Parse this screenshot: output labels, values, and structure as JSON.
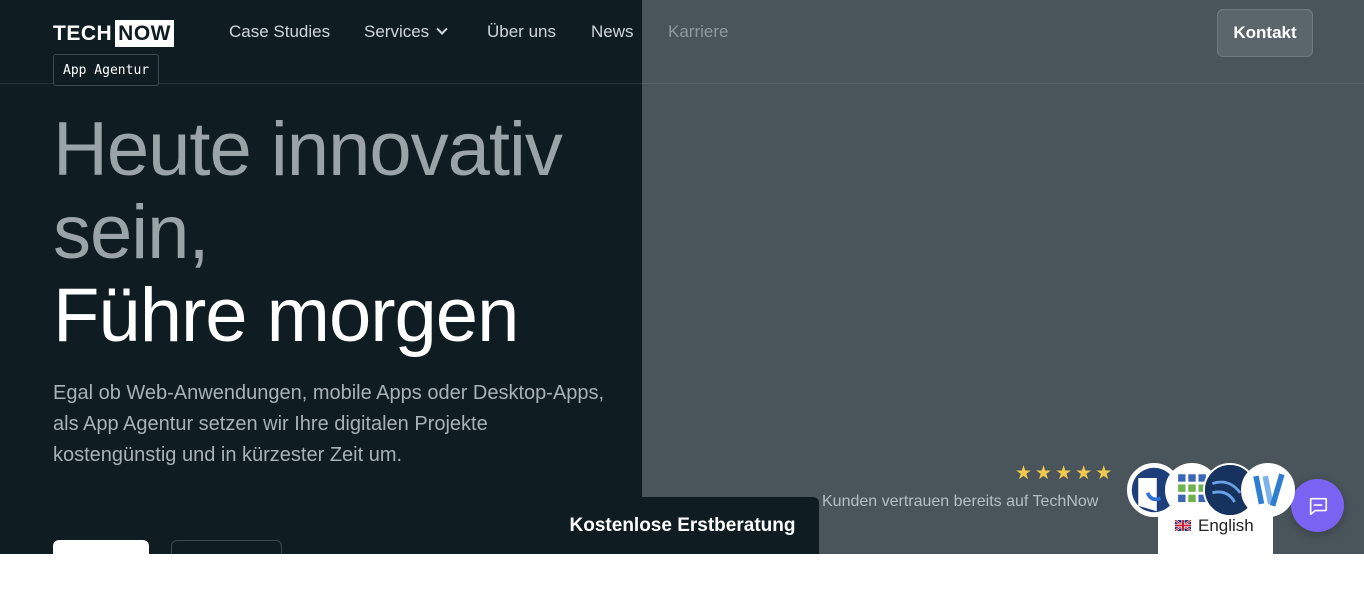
{
  "header": {
    "logo_part1": "TECH",
    "logo_part2": "NOW",
    "tag": "App Agentur",
    "nav": [
      {
        "label": "Case Studies"
      },
      {
        "label": "Services"
      },
      {
        "label": "Über uns"
      },
      {
        "label": "News"
      },
      {
        "label": "Karriere"
      }
    ],
    "contact_label": "Kontakt"
  },
  "hero": {
    "headline_line1": "Heute innovativ",
    "headline_line2": "sein,",
    "headline_line3": "Führe morgen",
    "description": "Egal ob Web-Anwendungen, mobile Apps oder Desktop-Apps, als App Agentur setzen wir Ihre digitalen Projekte kostengünstig und in kürzester Zeit um."
  },
  "trust": {
    "rating_stars": 5,
    "text": "Kunden vertrauen bereits auf TechNow"
  },
  "cta_label": "Kostenlose Erstberatung",
  "language": {
    "label": "English"
  },
  "colors": {
    "hero_dark": "#0f1d23",
    "hero_grey": "#4a555b",
    "star": "#f2c94c",
    "chat": "#7a63f2"
  }
}
